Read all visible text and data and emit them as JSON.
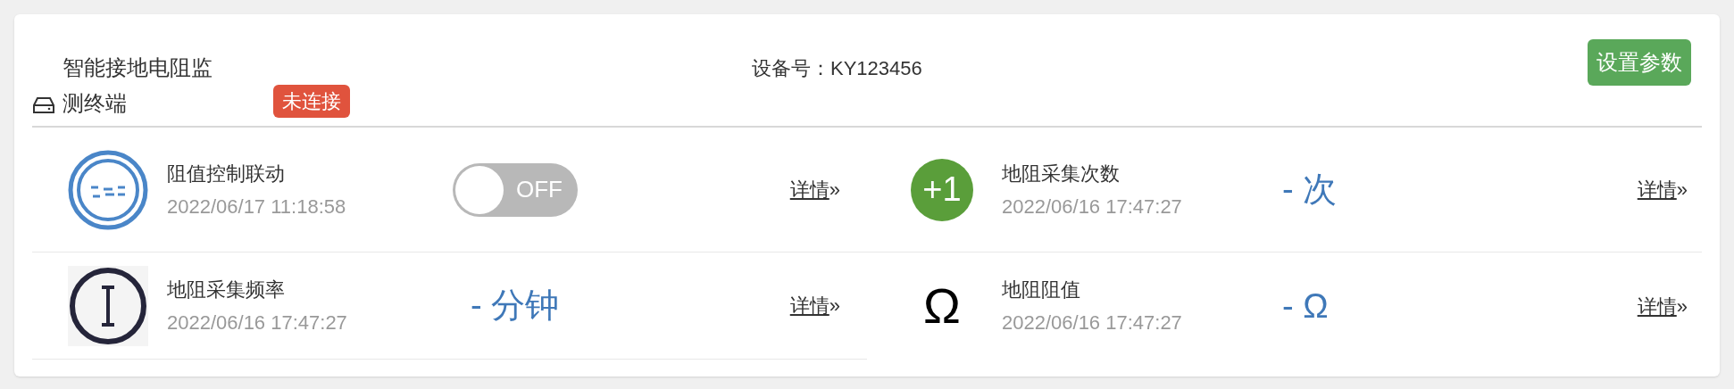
{
  "device": {
    "name": "智能接地电阻监测终端",
    "status": "未连接",
    "connected": false,
    "serial_label": "设备号：",
    "serial": "KY123456",
    "settings_button": "设置参数"
  },
  "items": [
    {
      "kind": "toggle",
      "title": "阻值控制联动",
      "time": "2022/06/17 11:18:58",
      "toggle_label": "OFF",
      "on": false,
      "link": "详情",
      "link_arrow": "»"
    },
    {
      "kind": "value",
      "icon_glyph": "+1",
      "title": "地阻采集次数",
      "time": "2022/06/16 17:47:27",
      "value": "- 次",
      "link": "详情",
      "link_arrow": "»"
    },
    {
      "kind": "value",
      "title": "地阻采集频率",
      "time": "2022/06/16 17:47:27",
      "value": "- 分钟",
      "link": "详情",
      "link_arrow": "»"
    },
    {
      "kind": "value",
      "icon_glyph": "Ω",
      "title": "地阻阻值",
      "time": "2022/06/16 17:47:27",
      "value": "- Ω",
      "link": "详情",
      "link_arrow": "»"
    }
  ]
}
